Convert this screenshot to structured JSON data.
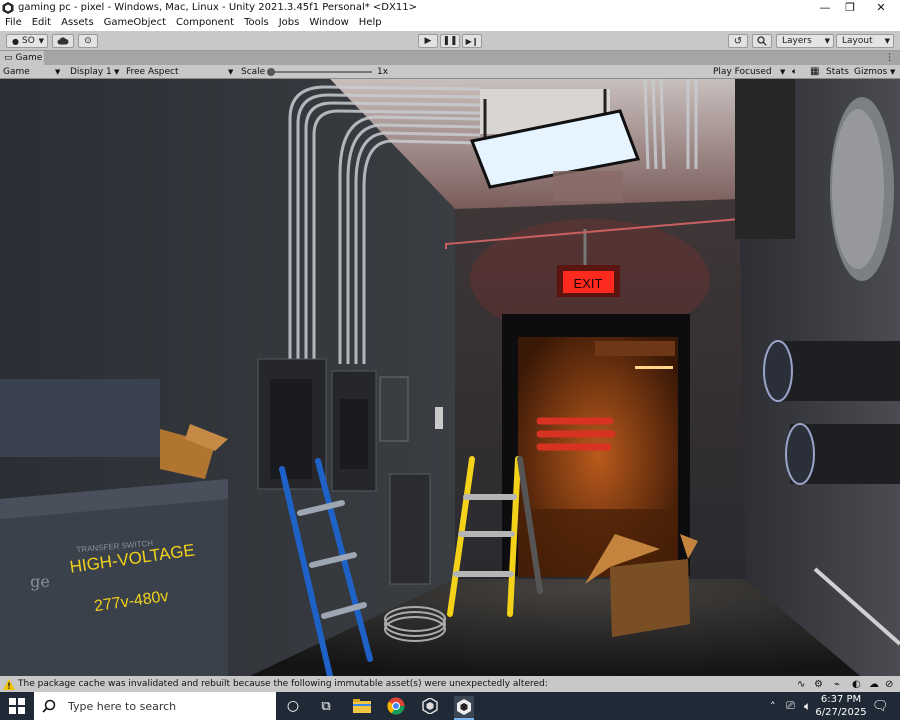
{
  "window": {
    "title": "gaming pc - pixel - Windows, Mac, Linux - Unity 2021.3.45f1 Personal* <DX11>",
    "minimize": "—",
    "maximize": "❐",
    "close": "✕"
  },
  "menu": [
    "File",
    "Edit",
    "Assets",
    "GameObject",
    "Component",
    "Tools",
    "Jobs",
    "Window",
    "Help"
  ],
  "toolbar": {
    "account_label": "SO",
    "layers_label": "Layers",
    "layout_label": "Layout"
  },
  "game_tab": {
    "label": "Game"
  },
  "game_toolbar": {
    "view_mode": "Game",
    "display": "Display 1",
    "aspect": "Free Aspect",
    "scale_label": "Scale",
    "scale_value": "1x",
    "play_mode": "Play Focused",
    "stats_label": "Stats",
    "gizmos_label": "Gizmos"
  },
  "scene": {
    "exit_sign": "EXIT",
    "transfer_switch": "TRANSFER SWITCH",
    "high_voltage": "HIGH-VOLTAGE",
    "voltage_range": "277v-480v",
    "logo": "ge"
  },
  "status": {
    "message": "The package cache was invalidated and rebuilt because the following immutable asset(s) were unexpectedly altered:"
  },
  "taskbar": {
    "search_placeholder": "Type here to search",
    "time": "6:37 PM",
    "date": "6/27/2025"
  },
  "colors": {
    "editor_bg": "#c8c8c8",
    "taskbar_bg": "#1f2a36",
    "exit_red": "#ff2a1f",
    "ladder_yellow": "#f5d21a",
    "ladder_blue": "#1e62c8",
    "warning_yellow": "#f2c200"
  }
}
